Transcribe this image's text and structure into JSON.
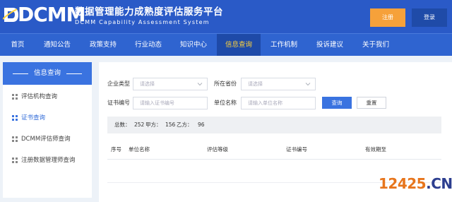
{
  "header": {
    "logo": "DCMM",
    "title": "数据管理能力成熟度评估服务平台",
    "subtitle": "DCMM Capability Assessment System",
    "register_label": "注册",
    "login_label": "登录"
  },
  "nav": {
    "items": [
      "首页",
      "通知公告",
      "政策支持",
      "行业动态",
      "知识中心",
      "信息查询",
      "工作机制",
      "投诉建议",
      "关于我们"
    ],
    "active": "信息查询"
  },
  "sidebar": {
    "title": "信息查询",
    "items": [
      "评估机构查询",
      "证书查询",
      "DCMM评估师查询",
      "注册数据管理师查询"
    ],
    "active": "证书查询"
  },
  "form": {
    "enterprise_type_label": "企业类型",
    "enterprise_type_placeholder": "请选择",
    "province_label": "所在省份",
    "province_placeholder": "请选择",
    "cert_no_label": "证书编号",
    "cert_no_placeholder": "请输入证书编号",
    "org_name_label": "单位名称",
    "org_name_placeholder": "请输入单位名称",
    "query_label": "查询",
    "reset_label": "重置"
  },
  "stats": {
    "total_label": "总数：",
    "total": "252",
    "party_a_label": "甲方：",
    "party_a": "156",
    "party_b_label": "乙方：",
    "party_b": "96"
  },
  "table": {
    "columns": [
      "序号",
      "单位名称",
      "评估等级",
      "证书编号",
      "有效期至"
    ]
  },
  "watermark": {
    "number": "12425",
    "domain": ".CN"
  },
  "colors": {
    "header_bg": "#2a5ac7",
    "nav_bg": "#2f64d0",
    "nav_active_bg": "#1e4aa8",
    "nav_active_text": "#ffd33b",
    "accent": "#3a73e0",
    "register_bg": "#f6a13a"
  }
}
